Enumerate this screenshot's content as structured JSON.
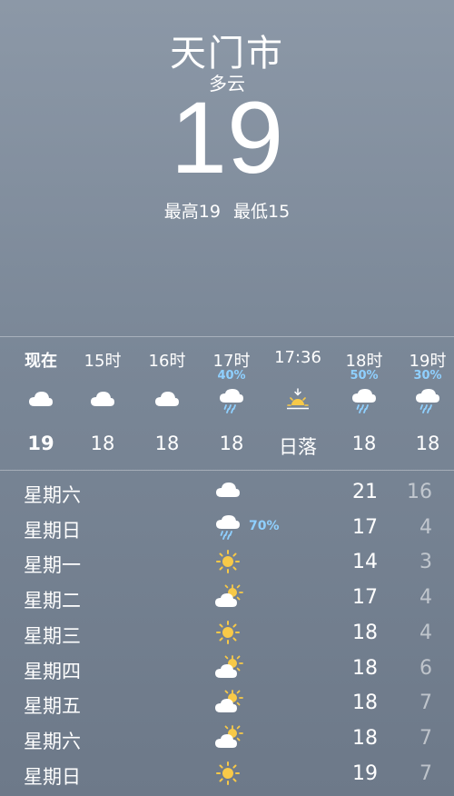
{
  "location": {
    "city": "天门市",
    "condition": "多云"
  },
  "current": {
    "temp": "19",
    "high_label": "最高19",
    "low_label": "最低15"
  },
  "hourly": [
    {
      "time": "现在",
      "pct": "",
      "icon": "cloud-icon",
      "value": "19"
    },
    {
      "time": "15时",
      "pct": "",
      "icon": "cloud-icon",
      "value": "18"
    },
    {
      "time": "16时",
      "pct": "",
      "icon": "cloud-icon",
      "value": "18"
    },
    {
      "time": "17时",
      "pct": "40%",
      "icon": "cloud-rain-icon",
      "value": "18"
    },
    {
      "time": "17:36",
      "pct": "",
      "icon": "sunset-icon",
      "value": "日落"
    },
    {
      "time": "18时",
      "pct": "50%",
      "icon": "cloud-rain-icon",
      "value": "18"
    },
    {
      "time": "19时",
      "pct": "30%",
      "icon": "cloud-rain-icon",
      "value": "18"
    }
  ],
  "daily": [
    {
      "day": "星期六",
      "icon": "cloud-icon",
      "pct": "",
      "high": "21",
      "low": "16"
    },
    {
      "day": "星期日",
      "icon": "cloud-rain-icon",
      "pct": "70%",
      "high": "17",
      "low": "4"
    },
    {
      "day": "星期一",
      "icon": "sun-icon",
      "pct": "",
      "high": "14",
      "low": "3"
    },
    {
      "day": "星期二",
      "icon": "partly-cloudy-icon",
      "pct": "",
      "high": "17",
      "low": "4"
    },
    {
      "day": "星期三",
      "icon": "sun-icon",
      "pct": "",
      "high": "18",
      "low": "4"
    },
    {
      "day": "星期四",
      "icon": "partly-cloudy-icon",
      "pct": "",
      "high": "18",
      "low": "6"
    },
    {
      "day": "星期五",
      "icon": "partly-cloudy-icon",
      "pct": "",
      "high": "18",
      "low": "7"
    },
    {
      "day": "星期六",
      "icon": "partly-cloudy-icon",
      "pct": "",
      "high": "18",
      "low": "7"
    },
    {
      "day": "星期日",
      "icon": "sun-icon",
      "pct": "",
      "high": "19",
      "low": "7"
    }
  ],
  "colors": {
    "precip": "#8fd0ff",
    "sun": "#f7c948"
  }
}
